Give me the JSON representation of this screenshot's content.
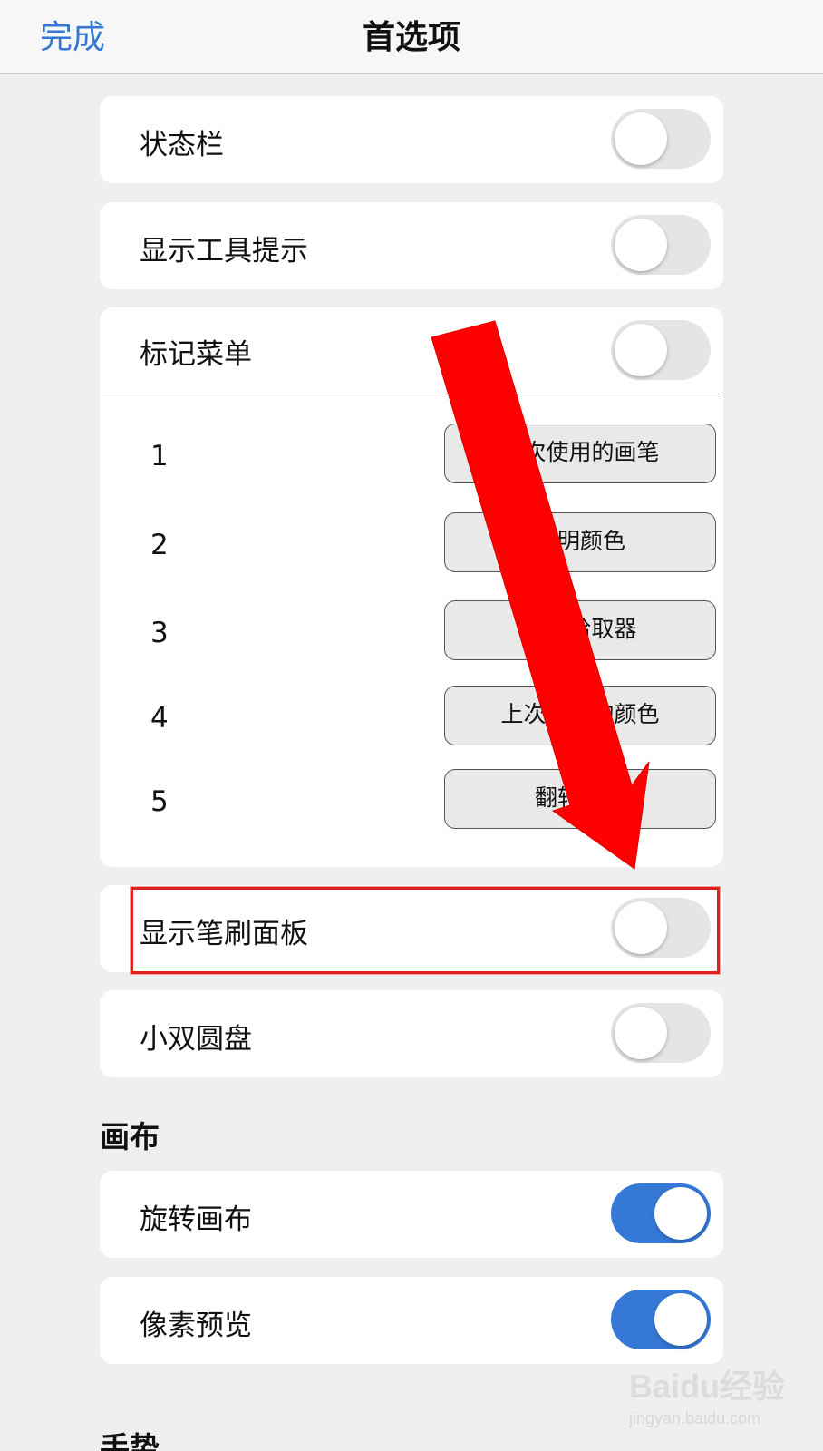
{
  "nav": {
    "done_label": "完成",
    "title": "首选项"
  },
  "rows": [
    {
      "label": "状态栏",
      "toggle": "off"
    },
    {
      "label": "显示工具提示",
      "toggle": "off"
    },
    {
      "label": "标记菜单",
      "toggle": "off"
    }
  ],
  "mark_menu": {
    "items": [
      {
        "num": "1",
        "label": "上次使用的画笔"
      },
      {
        "num": "2",
        "label": "透明颜色"
      },
      {
        "num": "3",
        "label": "颜色拾取器"
      },
      {
        "num": "4",
        "label": "上次使用的颜色"
      },
      {
        "num": "5",
        "label": "翻转画布"
      }
    ]
  },
  "brush_panel": {
    "label": "显示笔刷面板",
    "toggle": "off"
  },
  "dual_puck": {
    "label": "小双圆盘",
    "toggle": "off"
  },
  "canvas_section": {
    "header": "画布",
    "rows": [
      {
        "label": "旋转画布",
        "toggle": "on"
      },
      {
        "label": "像素预览",
        "toggle": "on"
      }
    ]
  },
  "gestures_section": {
    "header": "手势"
  },
  "watermark": {
    "logo": "Baidu经验",
    "sub": "jingyan.baidu.com"
  },
  "colors": {
    "accent": "#3578d6",
    "annotation": "#ff0000"
  }
}
